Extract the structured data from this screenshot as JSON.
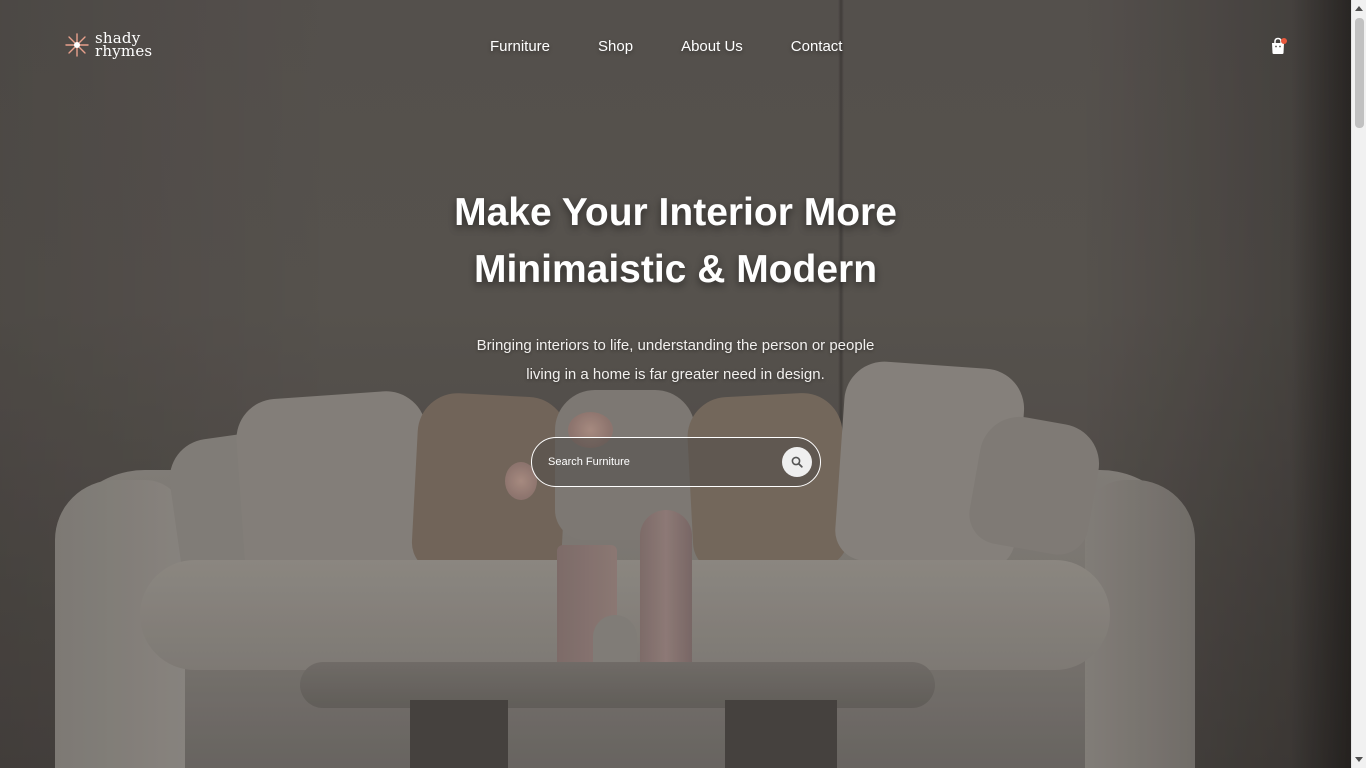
{
  "brand": {
    "name_line1": "shady",
    "name_line2": "rhymes",
    "icon": "sparkle-logo-icon",
    "accent_color": "#e8a08c"
  },
  "nav": {
    "items": [
      {
        "label": "Furniture"
      },
      {
        "label": "Shop"
      },
      {
        "label": "About Us"
      },
      {
        "label": "Contact"
      }
    ]
  },
  "cart": {
    "icon": "shopping-bag-icon",
    "badge_color": "#e8583c"
  },
  "hero": {
    "title_line1": "Make Your Interior More",
    "title_line2": "Minimaistic & Modern",
    "subtitle_line1": "Bringing interiors to life, understanding the person or people",
    "subtitle_line2": "living in a home is far greater need in design."
  },
  "search": {
    "placeholder": "Search Furniture",
    "value": "",
    "icon": "search-icon"
  }
}
